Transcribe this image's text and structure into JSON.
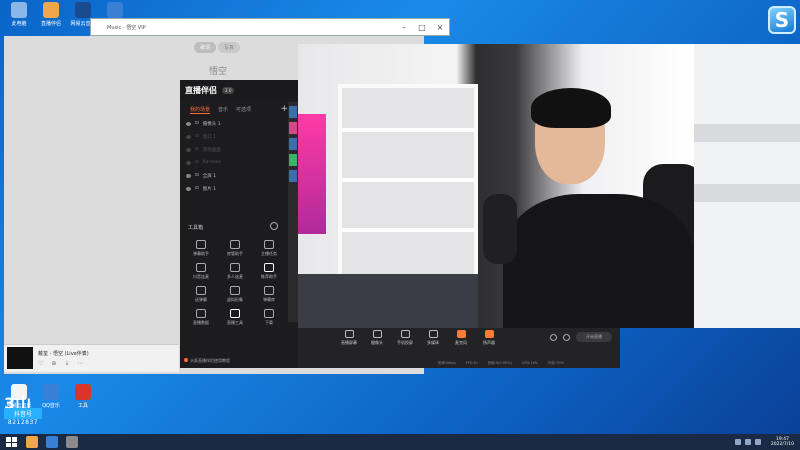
{
  "desktop": {
    "icons": [
      {
        "label": "此电脑",
        "color": "#8bb7e6"
      },
      {
        "label": "直播伴侣",
        "color": "#f0a64a"
      },
      {
        "label": "网易云音乐",
        "color": "#1a4a90"
      },
      {
        "label": "QQ音乐",
        "color": "#3a7fd6"
      }
    ],
    "bottom_icons": [
      {
        "label": "网易云音乐",
        "color": "#f5f5f5"
      },
      {
        "label": "QQ音乐",
        "color": "#3a7fd6"
      },
      {
        "label": "工具",
        "color": "#d9352b"
      }
    ],
    "counter_logo": "3山",
    "counter_label": "抖音号",
    "counter_value": "8212837"
  },
  "corner_logo": "S",
  "player": {
    "title": "Music - 悟空 VIP",
    "tabs": [
      "歌词",
      "写真"
    ],
    "artist": "悟空",
    "song": "戴荃 - 悟空 (Live伴奏)",
    "controls": [
      "♡",
      "⊕",
      "↓",
      "⋯"
    ]
  },
  "panel": {
    "title": "直播伴侣",
    "badge": "2.0",
    "tabs": [
      "我的场景",
      "音乐",
      "可选项"
    ],
    "sources": [
      {
        "label": "摄像头 1",
        "active": true
      },
      {
        "label": "窗口 1",
        "active": false
      },
      {
        "label": "游戏画面",
        "active": false
      },
      {
        "label": "Karaoke",
        "active": false
      },
      {
        "label": "全屏 1",
        "active": true
      },
      {
        "label": "图片 1",
        "active": true
      }
    ],
    "tools_title": "工具箱",
    "tools": [
      {
        "label": "弹幕助手",
        "new": false
      },
      {
        "label": "房管助手",
        "new": false
      },
      {
        "label": "主播任务",
        "new": false
      },
      {
        "label": "抖音连麦",
        "new": false
      },
      {
        "label": "多人连麦",
        "new": false
      },
      {
        "label": "推荐助手",
        "new": true
      },
      {
        "label": "送弹幕",
        "new": false
      },
      {
        "label": "虚拟形象",
        "new": false
      },
      {
        "label": "弹幕库",
        "new": false
      },
      {
        "label": "直播数据",
        "new": false
      },
      {
        "label": "直播工具",
        "new": true
      },
      {
        "label": "下载",
        "new": false
      }
    ],
    "footer": "头条直播伴侣使用教程"
  },
  "obs_bar": {
    "tools": [
      {
        "label": "直播屏幕",
        "hot": false
      },
      {
        "label": "摄像头",
        "hot": false
      },
      {
        "label": "手机投屏",
        "hot": false
      },
      {
        "label": "多媒体",
        "hot": false
      },
      {
        "label": "麦克风",
        "hot": true
      },
      {
        "label": "扬声器",
        "hot": true
      }
    ],
    "button": "开始直播",
    "stats": [
      "码率:0kb/s",
      "FPS:30",
      "丢帧:0(0.00%)",
      "CPU:14%",
      "内存:79%"
    ]
  },
  "taskbar": {
    "apps": [
      "#f0a64a",
      "#3a7fd6",
      "#8a8a8a"
    ],
    "time": "19:47",
    "date": "2022/7/10"
  }
}
